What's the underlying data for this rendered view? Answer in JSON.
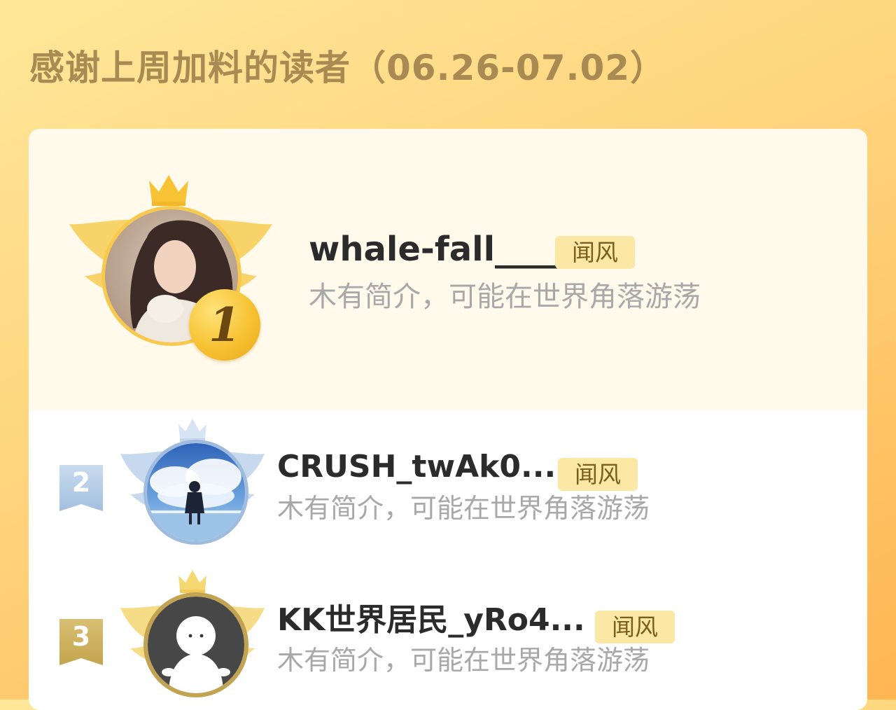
{
  "header": {
    "title": "感谢上周加料的读者（06.26-07.02）"
  },
  "colors": {
    "background_start": "#ffe79a",
    "background_end": "#ffb552",
    "card": "#ffffff",
    "first_card": "#fffaeb",
    "tag_bg": "#fbe8a4",
    "gold": "#f7c233",
    "silver_blue": "#a9c3e2",
    "bronze": "#c9ad5a"
  },
  "ranking": [
    {
      "rank": "1",
      "name": "whale-fall_____",
      "tag": "闻风",
      "description": "木有简介，可能在世界角落游荡",
      "avatar": "girl-portrait-avatar",
      "medal": "gold-medal-icon"
    },
    {
      "rank": "2",
      "name": "CRUSH_twAk0...",
      "tag": "闻风",
      "description": "木有简介，可能在世界角落游荡",
      "avatar": "sky-clouds-girl-avatar",
      "medal": "silver-ribbon-icon"
    },
    {
      "rank": "3",
      "name": "KK世界居民_yRo4...",
      "tag": "闻风",
      "description": "木有简介，可能在世界角落游荡",
      "avatar": "white-blob-character-avatar",
      "medal": "bronze-ribbon-icon"
    }
  ]
}
